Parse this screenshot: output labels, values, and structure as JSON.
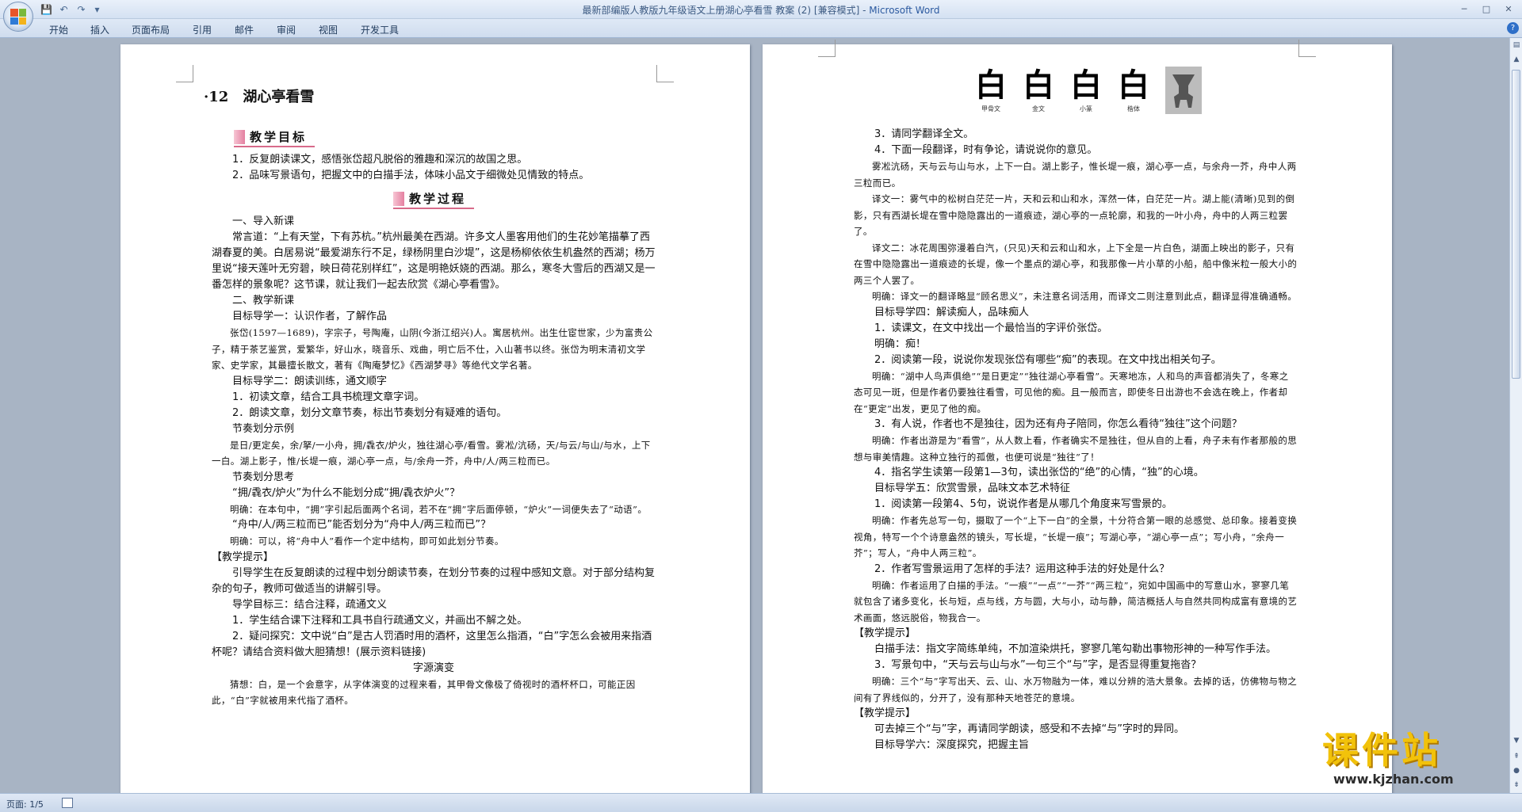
{
  "window": {
    "title_doc": "最新部编版人教版九年级语文上册湖心亭看雪 教案 (2) [兼容模式] - ",
    "title_app": "Microsoft Word",
    "minimize": "─",
    "maximize": "□",
    "close": "✕"
  },
  "quick_access": {
    "save": "💾",
    "undo": "↶",
    "redo": "↷",
    "customize": "▾"
  },
  "ribbon_tabs": [
    "开始",
    "插入",
    "页面布局",
    "引用",
    "邮件",
    "审阅",
    "视图",
    "开发工具"
  ],
  "help": "?",
  "page1": {
    "title": "·12　湖心亭看雪",
    "goal_head": "教学目标",
    "goals": [
      "1．反复朗读课文，感悟张岱超凡脱俗的雅趣和深沉的故国之思。",
      "2．品味写景语句，把握文中的白描手法，体味小品文于细微处见情致的特点。"
    ],
    "process_head": "教学过程",
    "lines": [
      {
        "t": "一、导入新课",
        "c": "p"
      },
      {
        "t": "常言道：“上有天堂，下有苏杭。”杭州最美在西湖。许多文人墨客用他们的生花妙笔描摹了西湖春夏的美。白居易说“最爱湖东行不足，绿杨阴里白沙堤”，这是杨柳依依生机盎然的西湖；杨万里说“接天莲叶无穷碧，映日荷花别样红”，这是明艳妖娆的西湖。那么，寒冬大雪后的西湖又是一番怎样的景象呢？这节课，就让我们一起去欣赏《湖心亭看雪》。",
        "c": "p"
      },
      {
        "t": "二、教学新课",
        "c": "p"
      },
      {
        "t": "目标导学一：认识作者，了解作品",
        "c": "p"
      },
      {
        "t": "张岱(1597—1689)，字宗子，号陶庵，山阴(今浙江绍兴)人。寓居杭州。出生仕宦世家，少为富贵公子，精于茶艺鉴赏，爱繁华，好山水，晓音乐、戏曲，明亡后不仕，入山著书以终。张岱为明末清初文学家、史学家，其最擅长散文，著有《陶庵梦忆》《西湖梦寻》等绝代文学名著。",
        "c": "p sm"
      },
      {
        "t": "目标导学二：朗读训练，通文顺字",
        "c": "p"
      },
      {
        "t": "1．初读文章，结合工具书梳理文章字词。",
        "c": "p"
      },
      {
        "t": "2．朗读文章，划分文章节奏，标出节奏划分有疑难的语句。",
        "c": "p"
      },
      {
        "t": "节奏划分示例",
        "c": "p"
      },
      {
        "t": "是日/更定矣，余/拏/一小舟，拥/毳衣/炉火，独往湖心亭/看雪。雾凇/沆砀，天/与云/与山/与水，上下一白。湖上影子，惟/长堤一痕，湖心亭一点，与/余舟一芥，舟中/人/两三粒而已。",
        "c": "p sm"
      },
      {
        "t": "节奏划分思考",
        "c": "p"
      },
      {
        "t": "“拥/毳衣/炉火”为什么不能划分成“拥/毳衣炉火”？",
        "c": "p"
      },
      {
        "t": "明确：在本句中，“拥”字引起后面两个名词，若不在“拥”字后面停顿，“炉火”一词便失去了“动语”。",
        "c": "p sm"
      },
      {
        "t": "“舟中/人/两三粒而已”能否划分为“舟中人/两三粒而已”？",
        "c": "p"
      },
      {
        "t": "明确：可以，将“舟中人”看作一个定中结构，即可如此划分节奏。",
        "c": "p sm"
      },
      {
        "t": "【教学提示】",
        "c": "p0"
      },
      {
        "t": "引导学生在反复朗读的过程中划分朗读节奏，在划分节奏的过程中感知文意。对于部分结构复杂的句子，教师可做适当的讲解引导。",
        "c": "p"
      },
      {
        "t": "导学目标三：结合注释，疏通文义",
        "c": "p"
      },
      {
        "t": "1．学生结合课下注释和工具书自行疏通文义，并画出不解之处。",
        "c": "p"
      },
      {
        "t": "2．疑问探究：文中说“白”是古人罚酒时用的酒杯，这里怎么指酒，“白”字怎么会被用来指酒杯呢？请结合资料做大胆猜想！(展示资料链接)",
        "c": "p"
      },
      {
        "t": "字源演变",
        "c": "center"
      },
      {
        "t": "猜想：白，是一个会意字，从字体演变的过程来看，其甲骨文像极了倚视时的酒杯杯口，可能正因此，“白”字就被用来代指了酒杯。",
        "c": "p sm"
      }
    ]
  },
  "page2": {
    "glyphs": [
      {
        "g": "白",
        "cap": "甲骨文"
      },
      {
        "g": "白",
        "cap": "金文"
      },
      {
        "g": "白",
        "cap": "小篆"
      },
      {
        "g": "白",
        "cap": "楷体"
      }
    ],
    "lines": [
      {
        "t": "3．请同学翻译全文。",
        "c": "p"
      },
      {
        "t": "4．下面一段翻译，时有争论，请说说你的意见。",
        "c": "p"
      },
      {
        "t": "雾凇沆砀，天与云与山与水，上下一白。湖上影子，惟长堤一痕，湖心亭一点，与余舟一芥，舟中人两三粒而已。",
        "c": "p sm"
      },
      {
        "t": "译文一：雾气中的松树白茫茫一片，天和云和山和水，浑然一体，白茫茫一片。湖上能(清晰)见到的倒影，只有西湖长堤在雪中隐隐露出的一道痕迹，湖心亭的一点轮廓，和我的一叶小舟，舟中的人两三粒罢了。",
        "c": "p sm"
      },
      {
        "t": "译文二：冰花周围弥漫着白汽，(只见)天和云和山和水，上下全是一片白色，湖面上映出的影子，只有在雪中隐隐露出一道痕迹的长堤，像一个墨点的湖心亭，和我那像一片小草的小船，船中像米粒一般大小的两三个人罢了。",
        "c": "p sm"
      },
      {
        "t": "明确：译文一的翻译略显“顾名思义”，未注意名词活用，而译文二则注意到此点，翻译显得准确通畅。",
        "c": "p sm"
      },
      {
        "t": "目标导学四：解读痴人，品味痴人",
        "c": "p"
      },
      {
        "t": "1．读课文，在文中找出一个最恰当的字评价张岱。",
        "c": "p"
      },
      {
        "t": "明确：痴！",
        "c": "p"
      },
      {
        "t": "2．阅读第一段，说说你发现张岱有哪些“痴”的表现。在文中找出相关句子。",
        "c": "p"
      },
      {
        "t": "明确：“湖中人鸟声俱绝”“是日更定”“独往湖心亭看雪”。天寒地冻，人和鸟的声音都消失了，冬寒之态可见一斑，但是作者仍要独往看雪，可见他的痴。且一般而言，即使冬日出游也不会选在晚上，作者却在“更定”出发，更见了他的痴。",
        "c": "p sm"
      },
      {
        "t": "3．有人说，作者也不是独往，因为还有舟子陪同，你怎么看待“独往”这个问题？",
        "c": "p"
      },
      {
        "t": "明确：作者出游是为“看雪”，从人数上看，作者确实不是独往，但从自的上看，舟子未有作者那般的思想与审美情趣。这种立独行的孤傲，也便可说是“独往”了！",
        "c": "p sm"
      },
      {
        "t": "4．指名学生读第一段第1—3句，读出张岱的“绝”的心情，“独”的心境。",
        "c": "p"
      },
      {
        "t": "目标导学五：欣赏雪景，品味文本艺术特征",
        "c": "p"
      },
      {
        "t": "1．阅读第一段第4、5句，说说作者是从哪几个角度来写雪景的。",
        "c": "p"
      },
      {
        "t": "明确：作者先总写一句，摄取了一个“上下一白”的全景，十分符合第一眼的总感觉、总印象。接着变换视角，特写一个个诗意盎然的镜头，写长堤，“长堤一痕”；写湖心亭，“湖心亭一点”；写小舟，“余舟一芥”；写人，“舟中人两三粒”。",
        "c": "p sm"
      },
      {
        "t": "2．作者写雪景运用了怎样的手法？运用这种手法的好处是什么？",
        "c": "p"
      },
      {
        "t": "明确：作者运用了白描的手法。“一痕”“一点”“一芥”“两三粒”，宛如中国画中的写意山水，寥寥几笔就包含了诸多变化，长与短，点与线，方与圆，大与小，动与静，简洁概括人与自然共同构成富有意境的艺术画面，悠远脱俗，物我合一。",
        "c": "p sm"
      },
      {
        "t": "【教学提示】",
        "c": "p0"
      },
      {
        "t": "白描手法：指文字简练单纯，不加渲染烘托，寥寥几笔勾勒出事物形神的一种写作手法。",
        "c": "p"
      },
      {
        "t": "3．写景句中，“天与云与山与水”一句三个“与”字，是否显得重复拖沓？",
        "c": "p"
      },
      {
        "t": "明确：三个“与”字写出天、云、山、水万物融为一体，难以分辨的浩大景象。去掉的话，仿佛物与物之间有了界线似的，分开了，没有那种天地苍茫的意境。",
        "c": "p sm"
      },
      {
        "t": "【教学提示】",
        "c": "p0"
      },
      {
        "t": "可去掉三个“与”字，再请同学朗读，感受和不去掉“与”字时的异同。",
        "c": "p"
      },
      {
        "t": "目标导学六：深度探究，把握主旨",
        "c": "p"
      }
    ]
  },
  "status": {
    "page": "页面: 1/5"
  },
  "watermark": {
    "big": "课件站",
    "url": "www.kjzhan.com"
  },
  "colors": {
    "accent": "#2b579a",
    "heading_underline": "#d86a8a",
    "watermark": "#f2c20a"
  }
}
